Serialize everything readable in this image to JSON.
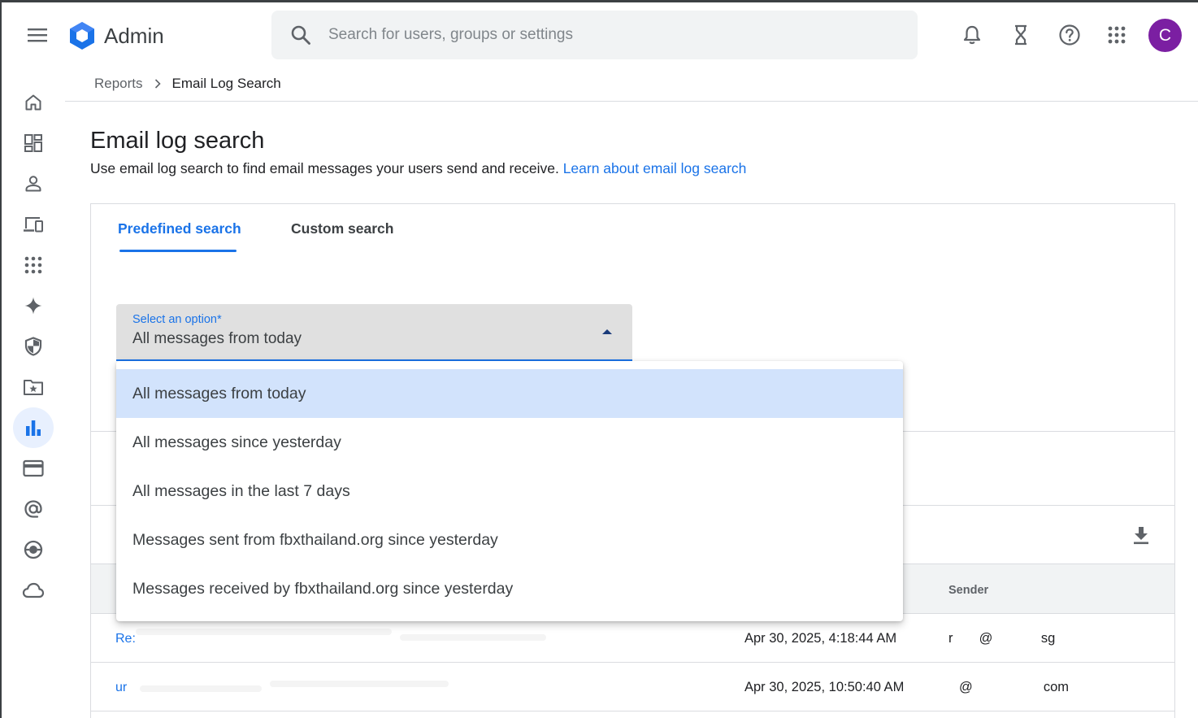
{
  "topbar": {
    "app_name": "Admin",
    "search_placeholder": "Search for users, groups or settings",
    "avatar_letter": "C",
    "avatar_color": "#7b1fa2"
  },
  "sidebar": {
    "items": [
      {
        "name": "home-icon",
        "active": false
      },
      {
        "name": "dashboard-icon",
        "active": false
      },
      {
        "name": "users-icon",
        "active": false
      },
      {
        "name": "devices-icon",
        "active": false
      },
      {
        "name": "apps-icon",
        "active": false
      },
      {
        "name": "sparkle-icon",
        "active": false
      },
      {
        "name": "security-shield-icon",
        "active": false
      },
      {
        "name": "folder-star-icon",
        "active": false
      },
      {
        "name": "reports-bar-chart-icon",
        "active": true
      },
      {
        "name": "billing-card-icon",
        "active": false
      },
      {
        "name": "at-sign-icon",
        "active": false
      },
      {
        "name": "directory-icon",
        "active": false
      },
      {
        "name": "cloud-icon",
        "active": false
      }
    ]
  },
  "breadcrumb": {
    "parent": "Reports",
    "current": "Email Log Search"
  },
  "page": {
    "title": "Email log search",
    "description": "Use email log search to find email messages your users send and receive.",
    "learn_link": "Learn about email log search"
  },
  "tabs": {
    "predefined": "Predefined search",
    "custom": "Custom search"
  },
  "select": {
    "label": "Select an option*",
    "value": "All messages from today",
    "options": [
      "All messages from today",
      "All messages since yesterday",
      "All messages in the last 7 days",
      "Messages sent from fbxthailand.org since yesterday",
      "Messages received by fbxthailand.org since yesterday"
    ]
  },
  "table": {
    "sender_header": "Sender",
    "rows": [
      {
        "subject": "Re:",
        "date": "Apr 30, 2025, 4:18:44 AM",
        "sender": "r       @             sg"
      },
      {
        "subject": "ur",
        "date": "Apr 30, 2025, 10:50:40 AM",
        "sender": "@                   com"
      }
    ]
  },
  "colors": {
    "accent": "#1a73e8",
    "selected_option_bg": "#d2e3fc"
  }
}
